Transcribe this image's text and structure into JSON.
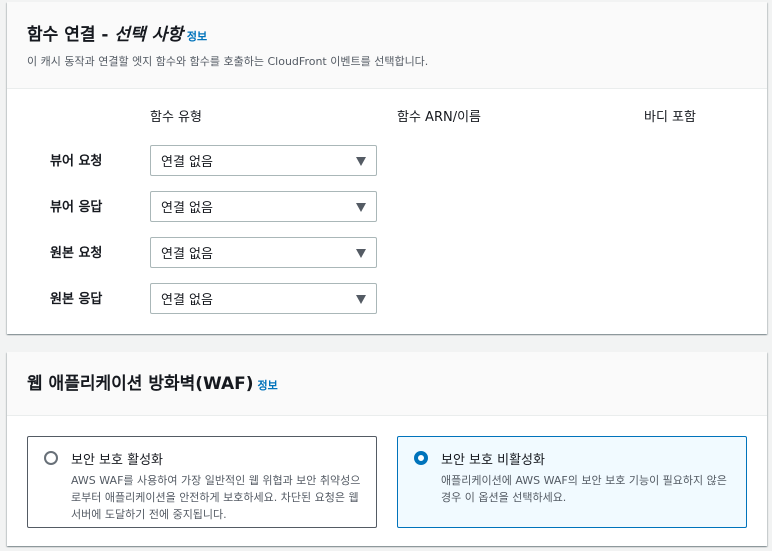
{
  "function_associations": {
    "title_main": "함수 연결 - ",
    "title_optional": "선택 사항",
    "info": "정보",
    "description": "이 캐시 동작과 연결할 엣지 함수와 함수를 호출하는 CloudFront 이벤트를 선택합니다.",
    "columns": {
      "function_type": "함수 유형",
      "function_arn": "함수 ARN/이름",
      "include_body": "바디 포함"
    },
    "rows": [
      {
        "label": "뷰어 요청",
        "value": "연결 없음"
      },
      {
        "label": "뷰어 응답",
        "value": "연결 없음"
      },
      {
        "label": "원본 요청",
        "value": "연결 없음"
      },
      {
        "label": "원본 응답",
        "value": "연결 없음"
      }
    ]
  },
  "waf": {
    "title": "웹 애플리케이션 방화벽(WAF)",
    "info": "정보",
    "options": [
      {
        "title": "보안 보호 활성화",
        "description": "AWS WAF를 사용하여 가장 일반적인 웹 위협과 보안 취약성으로부터 애플리케이션을 안전하게 보호하세요. 차단된 요청은 웹 서버에 도달하기 전에 중지됩니다.",
        "selected": false
      },
      {
        "title": "보안 보호 비활성화",
        "description": "애플리케이션에 AWS WAF의 보안 보호 기능이 필요하지 않은 경우 이 옵션을 선택하세요.",
        "selected": true
      }
    ]
  },
  "colors": {
    "accent": "#0073bb",
    "selected_bg": "#f1faff",
    "text": "#16191f",
    "muted": "#545b64"
  }
}
